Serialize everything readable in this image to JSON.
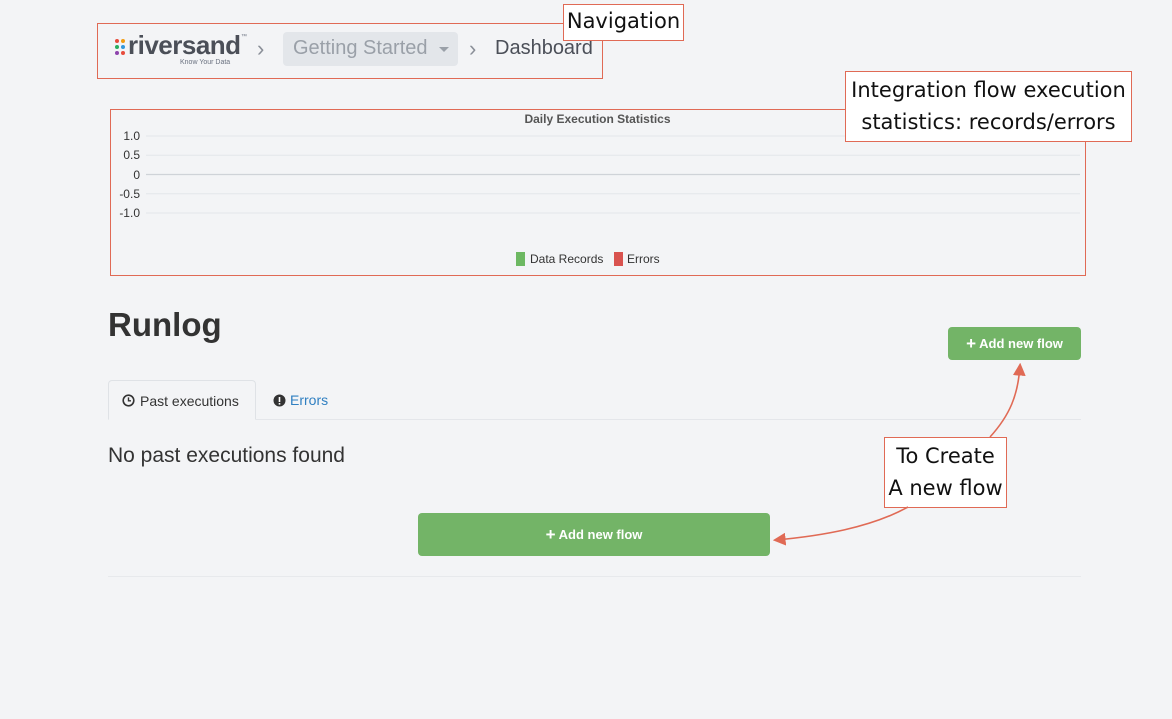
{
  "nav": {
    "logo_text": "riversand",
    "logo_tagline": "Know Your Data",
    "logo_tm": "™",
    "sep": "›",
    "crumb1": "Getting Started",
    "crumb2": "Dashboard"
  },
  "chart_data": {
    "type": "bar",
    "title": "Daily Execution Statistics",
    "y_ticks": [
      "1.0",
      "0.5",
      "0",
      "-0.5",
      "-1.0"
    ],
    "ylim": [
      -1.0,
      1.0
    ],
    "categories": [],
    "series": [
      {
        "name": "Data Records",
        "color": "#6db862",
        "values": []
      },
      {
        "name": "Errors",
        "color": "#d9534f",
        "values": []
      }
    ],
    "grid": true,
    "legend": "bottom-center"
  },
  "runlog": {
    "title": "Runlog",
    "add_button_top": "Add new flow",
    "tabs": [
      {
        "label": "Past executions",
        "icon": "clock-icon",
        "active": true
      },
      {
        "label": "Errors",
        "icon": "alert-icon",
        "active": false
      }
    ],
    "empty_text": "No past executions found",
    "add_button_main": "Add new flow"
  },
  "annotations": {
    "navigation": "Navigation",
    "stats_line1": "Integration flow execution",
    "stats_line2": "statistics: records/errors",
    "create_line1": "To Create",
    "create_line2": "A new flow",
    "color": "#e06a55"
  }
}
